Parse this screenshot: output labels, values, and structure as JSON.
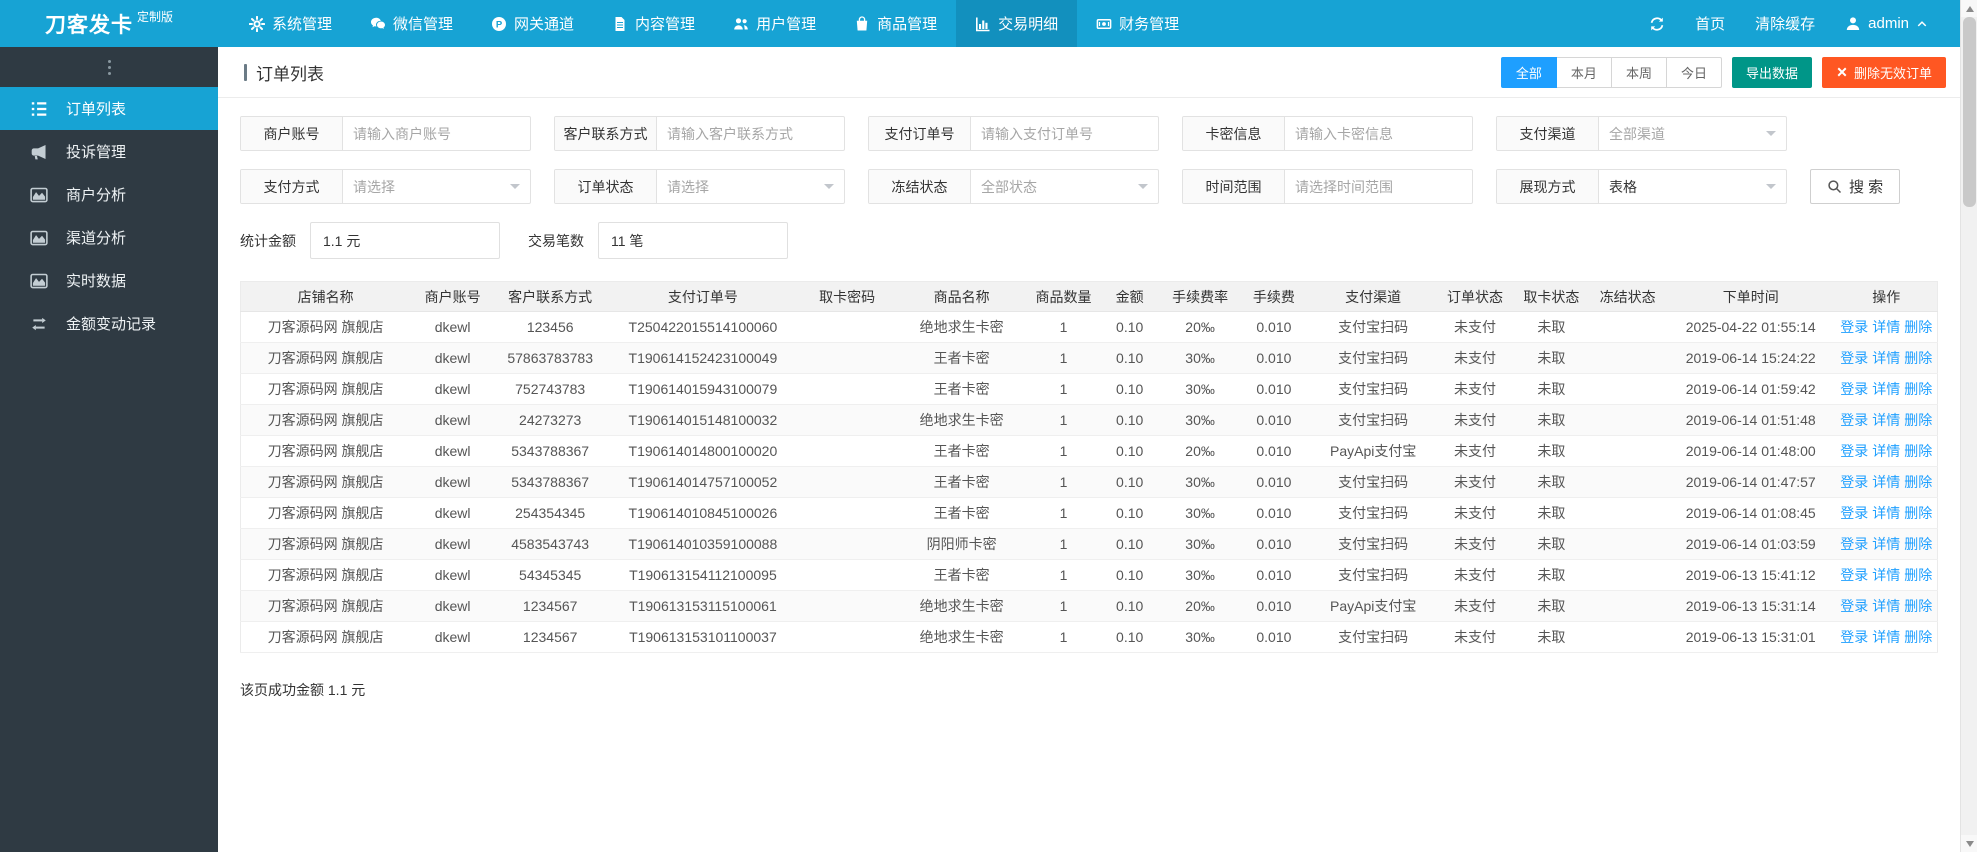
{
  "colors": {
    "topbar": "#17A3D4",
    "topbar_active": "#1290BE",
    "sidebar": "#2F3A43",
    "accent_blue": "#1E9FFF",
    "export_green": "#009688",
    "delete_orange": "#FF5722",
    "status_red": "#FF0000",
    "link_blue": "#1E9FFF"
  },
  "topbar": {
    "logo": "刀客发卡",
    "badge": "定制版",
    "menu": [
      {
        "name": "system",
        "icon": "gear",
        "label": "系统管理",
        "active": false
      },
      {
        "name": "wechat",
        "icon": "wechat",
        "label": "微信管理",
        "active": false
      },
      {
        "name": "gateway",
        "icon": "gateway",
        "label": "网关通道",
        "active": false
      },
      {
        "name": "content",
        "icon": "document",
        "label": "内容管理",
        "active": false
      },
      {
        "name": "user",
        "icon": "users",
        "label": "用户管理",
        "active": false
      },
      {
        "name": "goods",
        "icon": "bag",
        "label": "商品管理",
        "active": false
      },
      {
        "name": "trade",
        "icon": "chart-bars",
        "label": "交易明细",
        "active": true
      },
      {
        "name": "finance",
        "icon": "money",
        "label": "财务管理",
        "active": false
      }
    ],
    "home": "首页",
    "clear_cache": "清除缓存",
    "user": "admin"
  },
  "sidebar": {
    "items": [
      {
        "name": "order-list",
        "icon": "list-ordered",
        "label": "订单列表",
        "active": true
      },
      {
        "name": "complaint",
        "icon": "megaphone",
        "label": "投诉管理",
        "active": false
      },
      {
        "name": "merchant-analysis",
        "icon": "area-chart",
        "label": "商户分析",
        "active": false
      },
      {
        "name": "channel-analysis",
        "icon": "area-chart",
        "label": "渠道分析",
        "active": false
      },
      {
        "name": "realtime-data",
        "icon": "area-chart",
        "label": "实时数据",
        "active": false
      },
      {
        "name": "balance-log",
        "icon": "exchange",
        "label": "金额变动记录",
        "active": false
      }
    ]
  },
  "page": {
    "title": "订单列表",
    "range_tabs": [
      {
        "name": "all",
        "label": "全部",
        "active": true
      },
      {
        "name": "month",
        "label": "本月",
        "active": false
      },
      {
        "name": "week",
        "label": "本周",
        "active": false
      },
      {
        "name": "today",
        "label": "今日",
        "active": false
      }
    ],
    "export_button": "导出数据",
    "delete_button": "删除无效订单",
    "search_button": "搜 索",
    "filters_row1": [
      {
        "name": "merchant-account",
        "label": "商户账号",
        "type": "input",
        "placeholder": "请输入商户账号"
      },
      {
        "name": "customer-contact",
        "label": "客户联系方式",
        "type": "input",
        "placeholder": "请输入客户联系方式"
      },
      {
        "name": "payment-order-no",
        "label": "支付订单号",
        "type": "input",
        "placeholder": "请输入支付订单号"
      },
      {
        "name": "card-info",
        "label": "卡密信息",
        "type": "input",
        "placeholder": "请输入卡密信息"
      },
      {
        "name": "payment-channel",
        "label": "支付渠道",
        "type": "select",
        "value": "全部渠道",
        "muted": true
      }
    ],
    "filters_row2": [
      {
        "name": "payment-method",
        "label": "支付方式",
        "type": "select",
        "value": "请选择",
        "muted": true
      },
      {
        "name": "order-status",
        "label": "订单状态",
        "type": "select",
        "value": "请选择",
        "muted": true
      },
      {
        "name": "freeze-status",
        "label": "冻结状态",
        "type": "select",
        "value": "全部状态",
        "muted": true
      },
      {
        "name": "time-range",
        "label": "时间范围",
        "type": "input",
        "placeholder": "请选择时间范围"
      },
      {
        "name": "display-mode",
        "label": "展现方式",
        "type": "select",
        "value": "表格",
        "muted": false
      }
    ],
    "stats": [
      {
        "name": "total-amount",
        "label": "统计金额",
        "value": "1.1 元"
      },
      {
        "name": "trade-count",
        "label": "交易笔数",
        "value": "11 笔"
      }
    ],
    "footer": "该页成功金额 1.1 元"
  },
  "table": {
    "headers": [
      {
        "key": "shop",
        "label": "店铺名称"
      },
      {
        "key": "merchant",
        "label": "商户账号"
      },
      {
        "key": "contact",
        "label": "客户联系方式"
      },
      {
        "key": "order_no",
        "label": "支付订单号"
      },
      {
        "key": "card_code",
        "label": "取卡密码"
      },
      {
        "key": "product",
        "label": "商品名称"
      },
      {
        "key": "qty",
        "label": "商品数量"
      },
      {
        "key": "amount",
        "label": "金额"
      },
      {
        "key": "fee_rate",
        "label": "手续费率"
      },
      {
        "key": "fee",
        "label": "手续费"
      },
      {
        "key": "channel",
        "label": "支付渠道"
      },
      {
        "key": "order_status",
        "label": "订单状态"
      },
      {
        "key": "card_status",
        "label": "取卡状态"
      },
      {
        "key": "freeze_status",
        "label": "冻结状态"
      },
      {
        "key": "time",
        "label": "下单时间"
      },
      {
        "key": "actions",
        "label": "操作"
      }
    ],
    "action_labels": [
      "登录",
      "详情",
      "删除"
    ],
    "rows": [
      {
        "shop": "刀客源码网 旗舰店",
        "merchant": "dkewl",
        "contact": "123456",
        "order_no": "T250422015514100060",
        "card_code": "",
        "product": "绝地求生卡密",
        "qty": "1",
        "amount": "0.10",
        "fee_rate": "20‰",
        "fee": "0.010",
        "channel": "支付宝扫码",
        "order_status": "未支付",
        "card_status": "未取",
        "freeze_status": "",
        "time": "2025-04-22 01:55:14"
      },
      {
        "shop": "刀客源码网 旗舰店",
        "merchant": "dkewl",
        "contact": "57863783783",
        "order_no": "T190614152423100049",
        "card_code": "",
        "product": "王者卡密",
        "qty": "1",
        "amount": "0.10",
        "fee_rate": "30‰",
        "fee": "0.010",
        "channel": "支付宝扫码",
        "order_status": "未支付",
        "card_status": "未取",
        "freeze_status": "",
        "time": "2019-06-14 15:24:22"
      },
      {
        "shop": "刀客源码网 旗舰店",
        "merchant": "dkewl",
        "contact": "752743783",
        "order_no": "T190614015943100079",
        "card_code": "",
        "product": "王者卡密",
        "qty": "1",
        "amount": "0.10",
        "fee_rate": "30‰",
        "fee": "0.010",
        "channel": "支付宝扫码",
        "order_status": "未支付",
        "card_status": "未取",
        "freeze_status": "",
        "time": "2019-06-14 01:59:42"
      },
      {
        "shop": "刀客源码网 旗舰店",
        "merchant": "dkewl",
        "contact": "24273273",
        "order_no": "T190614015148100032",
        "card_code": "",
        "product": "绝地求生卡密",
        "qty": "1",
        "amount": "0.10",
        "fee_rate": "30‰",
        "fee": "0.010",
        "channel": "支付宝扫码",
        "order_status": "未支付",
        "card_status": "未取",
        "freeze_status": "",
        "time": "2019-06-14 01:51:48"
      },
      {
        "shop": "刀客源码网 旗舰店",
        "merchant": "dkewl",
        "contact": "5343788367",
        "order_no": "T190614014800100020",
        "card_code": "",
        "product": "王者卡密",
        "qty": "1",
        "amount": "0.10",
        "fee_rate": "20‰",
        "fee": "0.010",
        "channel": "PayApi支付宝",
        "order_status": "未支付",
        "card_status": "未取",
        "freeze_status": "",
        "time": "2019-06-14 01:48:00"
      },
      {
        "shop": "刀客源码网 旗舰店",
        "merchant": "dkewl",
        "contact": "5343788367",
        "order_no": "T190614014757100052",
        "card_code": "",
        "product": "王者卡密",
        "qty": "1",
        "amount": "0.10",
        "fee_rate": "30‰",
        "fee": "0.010",
        "channel": "支付宝扫码",
        "order_status": "未支付",
        "card_status": "未取",
        "freeze_status": "",
        "time": "2019-06-14 01:47:57"
      },
      {
        "shop": "刀客源码网 旗舰店",
        "merchant": "dkewl",
        "contact": "254354345",
        "order_no": "T190614010845100026",
        "card_code": "",
        "product": "王者卡密",
        "qty": "1",
        "amount": "0.10",
        "fee_rate": "30‰",
        "fee": "0.010",
        "channel": "支付宝扫码",
        "order_status": "未支付",
        "card_status": "未取",
        "freeze_status": "",
        "time": "2019-06-14 01:08:45"
      },
      {
        "shop": "刀客源码网 旗舰店",
        "merchant": "dkewl",
        "contact": "4583543743",
        "order_no": "T190614010359100088",
        "card_code": "",
        "product": "阴阳师卡密",
        "qty": "1",
        "amount": "0.10",
        "fee_rate": "30‰",
        "fee": "0.010",
        "channel": "支付宝扫码",
        "order_status": "未支付",
        "card_status": "未取",
        "freeze_status": "",
        "time": "2019-06-14 01:03:59"
      },
      {
        "shop": "刀客源码网 旗舰店",
        "merchant": "dkewl",
        "contact": "54345345",
        "order_no": "T190613154112100095",
        "card_code": "",
        "product": "王者卡密",
        "qty": "1",
        "amount": "0.10",
        "fee_rate": "30‰",
        "fee": "0.010",
        "channel": "支付宝扫码",
        "order_status": "未支付",
        "card_status": "未取",
        "freeze_status": "",
        "time": "2019-06-13 15:41:12"
      },
      {
        "shop": "刀客源码网 旗舰店",
        "merchant": "dkewl",
        "contact": "1234567",
        "order_no": "T190613153115100061",
        "card_code": "",
        "product": "绝地求生卡密",
        "qty": "1",
        "amount": "0.10",
        "fee_rate": "20‰",
        "fee": "0.010",
        "channel": "PayApi支付宝",
        "order_status": "未支付",
        "card_status": "未取",
        "freeze_status": "",
        "time": "2019-06-13 15:31:14"
      },
      {
        "shop": "刀客源码网 旗舰店",
        "merchant": "dkewl",
        "contact": "1234567",
        "order_no": "T190613153101100037",
        "card_code": "",
        "product": "绝地求生卡密",
        "qty": "1",
        "amount": "0.10",
        "fee_rate": "30‰",
        "fee": "0.010",
        "channel": "支付宝扫码",
        "order_status": "未支付",
        "card_status": "未取",
        "freeze_status": "",
        "time": "2019-06-13 15:31:01"
      }
    ]
  }
}
